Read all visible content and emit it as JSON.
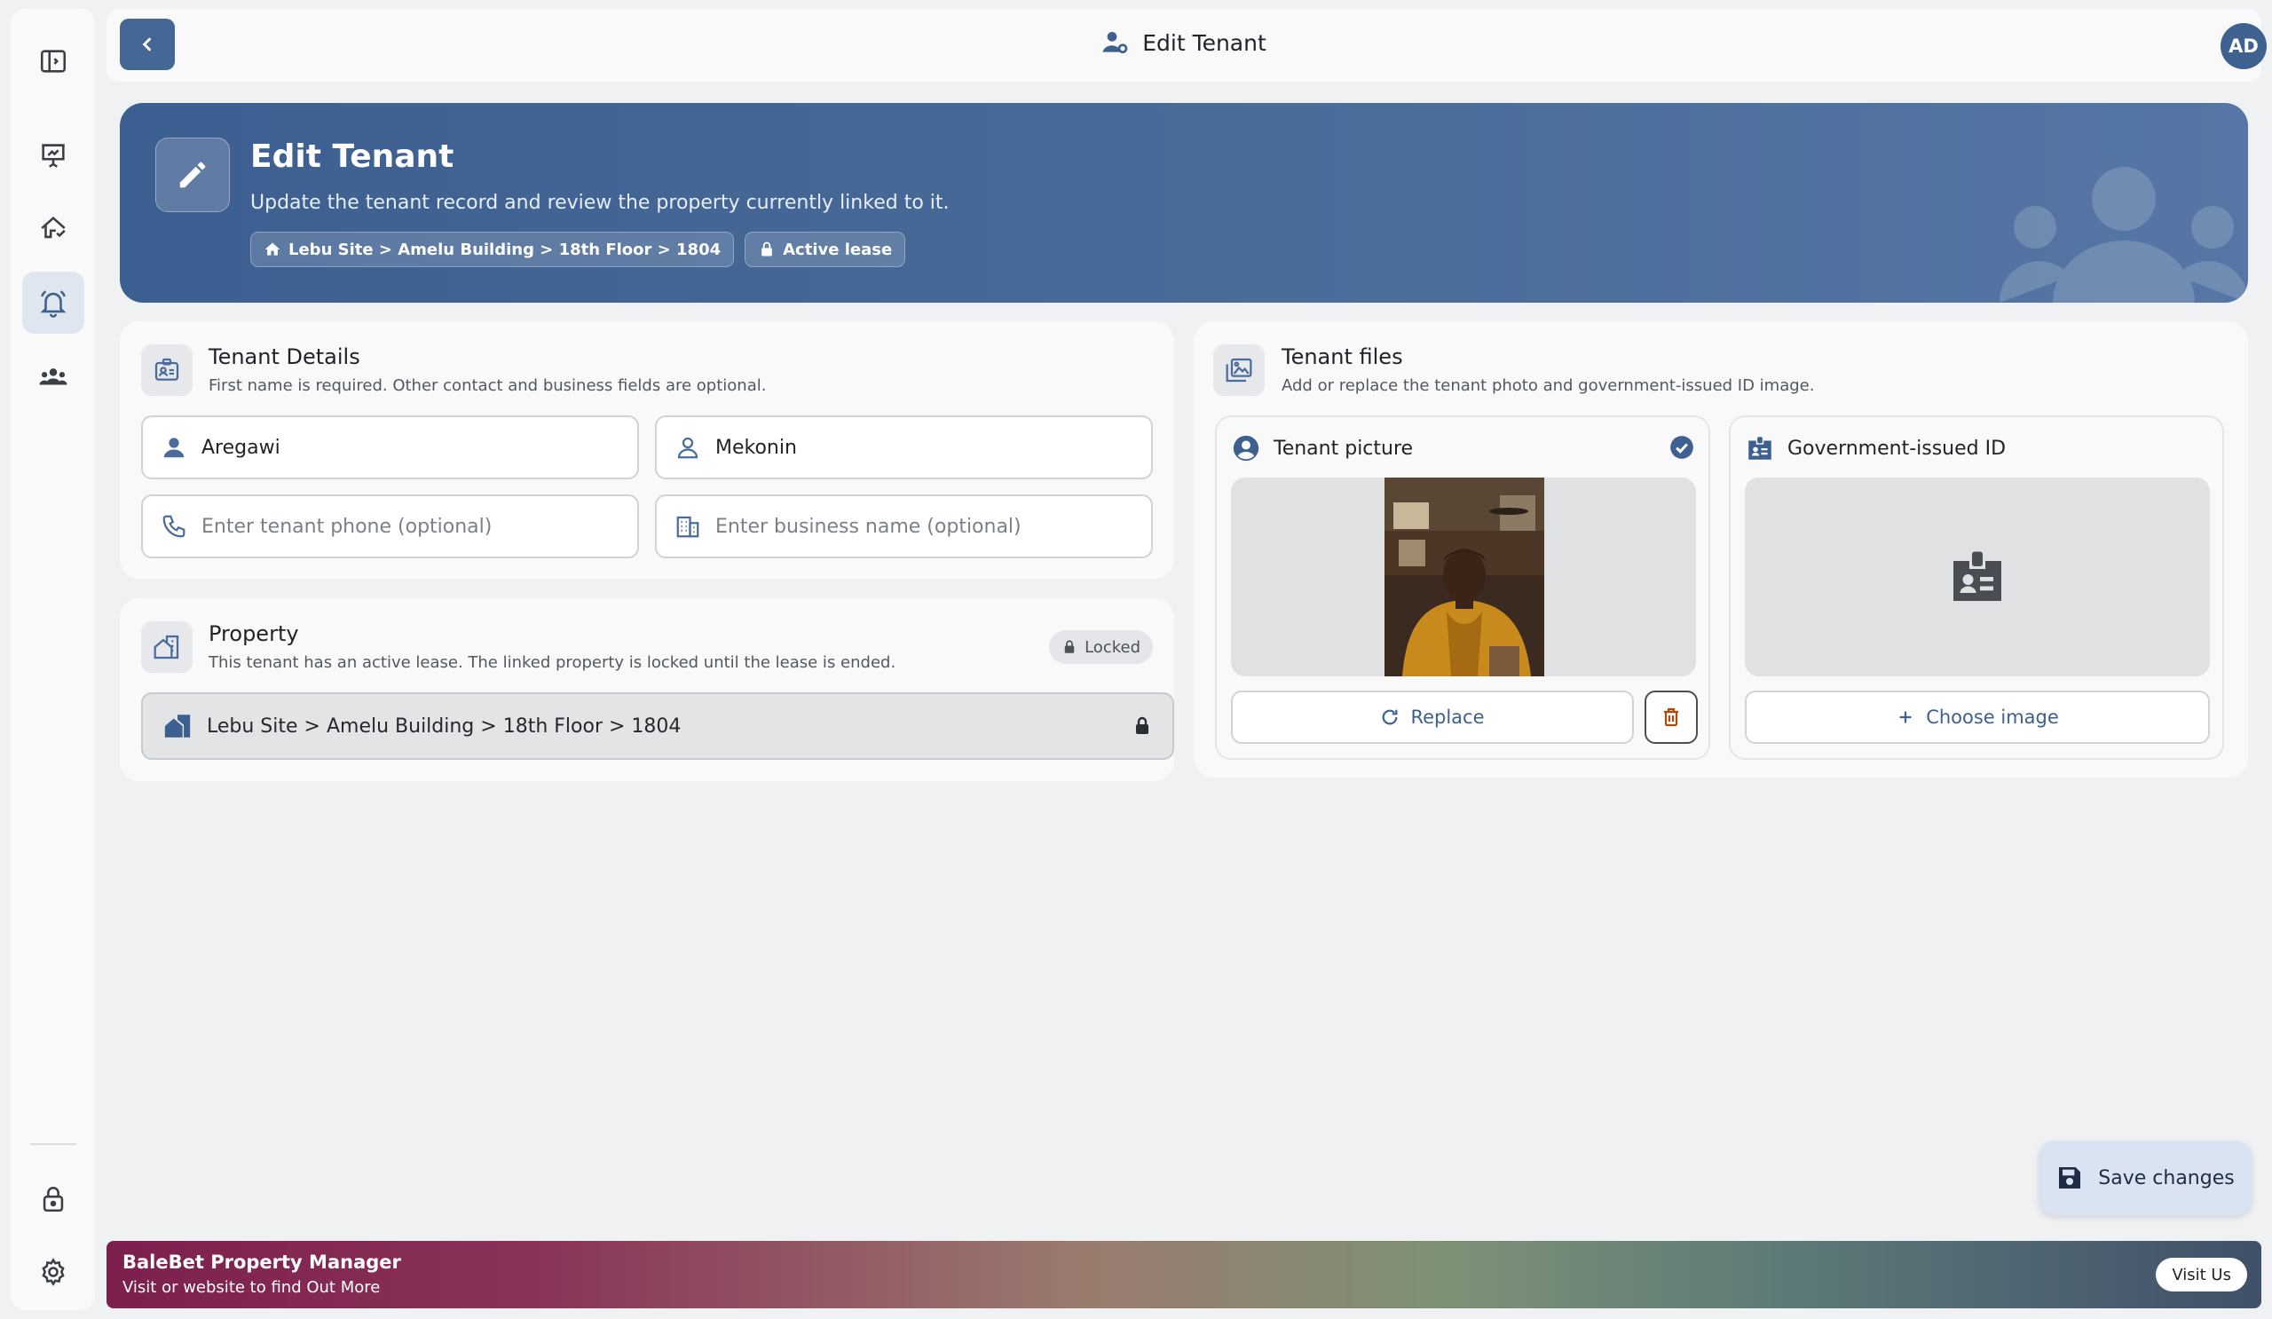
{
  "topbar": {
    "title": "Edit Tenant",
    "avatar_initials": "AD"
  },
  "hero": {
    "title": "Edit Tenant",
    "subtitle": "Update the tenant record and review the property currently linked to it.",
    "location_chip": "Lebu Site > Amelu Building > 18th Floor > 1804",
    "status_chip": "Active lease"
  },
  "tenant_details": {
    "title": "Tenant Details",
    "subtitle": "First name is required. Other contact and business fields are optional.",
    "first_name": "Aregawi",
    "last_name": "Mekonin",
    "phone_placeholder": "Enter tenant phone (optional)",
    "business_placeholder": "Enter business name (optional)"
  },
  "property": {
    "title": "Property",
    "subtitle": "This tenant has an active lease. The linked property is locked until the lease is ended.",
    "locked_label": "Locked",
    "value": "Lebu Site > Amelu Building > 18th Floor > 1804"
  },
  "tenant_files": {
    "title": "Tenant files",
    "subtitle": "Add or replace the tenant photo and government-issued ID image.",
    "picture": {
      "title": "Tenant picture",
      "replace_label": "Replace"
    },
    "gov_id": {
      "title": "Government-issued ID",
      "choose_label": "Choose image"
    }
  },
  "save_label": "Save changes",
  "footer": {
    "title": "BaleBet Property Manager",
    "subtitle": "Visit or website to find Out More",
    "visit_label": "Visit Us"
  },
  "colors": {
    "primary": "#446795",
    "accent_light": "#d9e3f2",
    "background": "#f0f1f3"
  }
}
